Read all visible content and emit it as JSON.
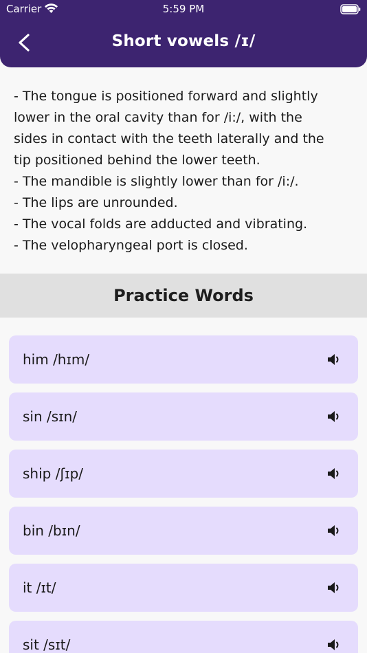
{
  "status_bar": {
    "carrier": "Carrier",
    "time": "5:59 PM"
  },
  "header": {
    "title": "Short vowels /ɪ/",
    "back_icon": "chevron-left-icon"
  },
  "description": {
    "lines": [
      "- The tongue is positioned forward and slightly",
      "lower in the oral cavity than for /i:/, with the",
      "sides in contact with the teeth laterally and the",
      "tip positioned behind the lower teeth.",
      "- The mandible is slightly lower than for /i:/.",
      "- The lips are unrounded.",
      "- The vocal folds are adducted and vibrating.",
      "- The velopharyngeal port is closed."
    ]
  },
  "section": {
    "title": "Practice Words"
  },
  "words": [
    {
      "text": "him /hɪm/"
    },
    {
      "text": "sin /sɪn/"
    },
    {
      "text": "ship /ʃɪp/"
    },
    {
      "text": "bin /bɪn/"
    },
    {
      "text": "it /ɪt/"
    },
    {
      "text": "sit /sɪt/"
    }
  ],
  "colors": {
    "header": "#3d2470",
    "card": "#e5dcfd",
    "band": "#e0e0e0"
  }
}
